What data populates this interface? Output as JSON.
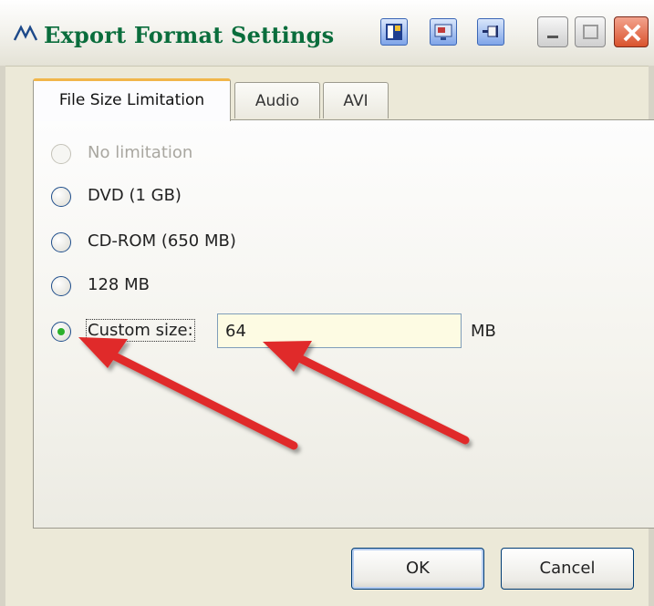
{
  "window": {
    "title": "Export Format Settings",
    "title_color": "#0a6d3c",
    "app_icon": "app-logo-icon",
    "toolbar_icons": [
      "layout-icon",
      "monitor-icon",
      "pin-icon"
    ],
    "controls": [
      "minimize-icon",
      "maximize-icon",
      "close-icon"
    ]
  },
  "tabs": [
    {
      "label": "File Size Limitation",
      "active": true
    },
    {
      "label": "Audio",
      "active": false
    },
    {
      "label": "AVI",
      "active": false
    }
  ],
  "options": [
    {
      "label": "No limitation",
      "enabled": false,
      "selected": false
    },
    {
      "label": "DVD (1 GB)",
      "enabled": true,
      "selected": false
    },
    {
      "label": "CD-ROM (650 MB)",
      "enabled": true,
      "selected": false
    },
    {
      "label": "128 MB",
      "enabled": true,
      "selected": false
    },
    {
      "label": "Custom size:",
      "enabled": true,
      "selected": true
    }
  ],
  "custom_size": {
    "value": "64",
    "unit": "MB"
  },
  "buttons": {
    "ok": "OK",
    "cancel": "Cancel"
  },
  "annotation": {
    "arrow_color": "#e02a2a",
    "arrow_count": 2
  },
  "colors": {
    "selected_tab_accent": "#f1b64a",
    "radio_selected_dot": "#2bb02b",
    "input_background": "#fdfbe3"
  }
}
